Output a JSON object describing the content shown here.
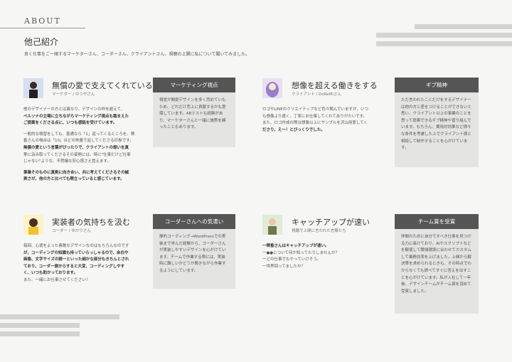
{
  "header": {
    "about": "ABOUT",
    "title": "他己紹介",
    "intro": "良く仕事をご一緒するマーケターさん、コーダーさん、クライアントさん、視聴の上関に私について聞いてみました。"
  },
  "cards": [
    {
      "title": "無償の愛で支えてくれている",
      "subtitle": "マーケター / のうやさん",
      "body": [
        "他のデザイナーの方とは異なり、デザインの枠を超えて、",
        "ベルソナの立場に立ちながらマーケティング視点も踏まえた",
        "ご提案をくださる点に、いつも感銘を受けています。",
        "一般的な慣習をしても、普通なら「1」返ってくるところを、稗",
        "畜さんの場合は「10」ほどの熱量で返してくださる印象です。",
        "無償の愛という言葉がぴったりで、クライアントの想いを真",
        "摯に汲み取ってくださるその姿勢には、時に\"仕事だけど仕事",
        "じゃない\"ような、不思議な安心感さえ覚えます。",
        "事業そのものに真剣に向き合い、共に考えてくださるその誠",
        "実さが、他の方と比べても際立っていると感じています。"
      ],
      "side_title": "マーケティング視点",
      "side_body": "視覚が間提デザインを多く売めていもため、どれだけ売上に貢献するかも意識しています。ABテストも経験があり、マーケターさんと一緒に施策を練ったこともあります。"
    },
    {
      "title": "想像を超える働きをする",
      "subtitle": "クライアント / DoReMiさん",
      "body": [
        "ロゴやLINEのクリエイティブなど色々頼んでいますが、いつ",
        "も想像より速く、丁寧にお仕事してくれてありがたいです。",
        "また、ロゴ作成の際は想像以上にサンプルを沢山用意してく",
        "ださり、え〜！とびっくりでした。"
      ],
      "side_title": "ギブ精神",
      "side_body": "ただ言われたことだけをするデザイナーは他の方と差をつけることができないと思い、クライアント以上の事業のことを思って提案できるギブ精神や習り組んでいます。もちろん、費用対効果など様々な条件を考慮した上でクライアント様と相談して制作することを心がけています。"
    },
    {
      "title": "実装者の気持ちを汲む",
      "subtitle": "コーダー / ゆかりさん",
      "body": [
        "毎回、心遣をよった素敵なデザインなのはもちろんなのです",
        "が、コーディングの知識も持っていらっしゃるので、余白や",
        "画像、文字サイズの統一といった細かな部分もきちんとされ",
        "ており、コーダー側からすると大変、コーディングしやす",
        "く、いつも助かっております。",
        "また、一緒にお仕事させてください！"
      ],
      "side_title": "コーダーさんへの気遣い",
      "side_body": "静的コーディング→WordPressでの実装まで学んだ経験から、コーダーさんが実装しやすいデザインを心がけています。チームで作業する際には、実装時に難しいかどうか聞きながら作業するようにしています。"
    },
    {
      "title": "キャッチアップが速い",
      "subtitle": "視聴で上関に言われた言葉たち",
      "body": [
        "一稗畜さんはキャッチアップが速い。",
        "一●●について何か知ってたりしませんか？",
        "一どの仕事でもやっていけそう。",
        "一世界回ってましたか？"
      ],
      "side_title": "チーム賞を受賞",
      "side_body": "仲間のために自分ですべき仕事を見つける力に長けており、AIやスクリプトなどを駆使して職場環境に合わせてカスタムして業務効率を上げました。上関から解決策を求められるときも、その時点でわからなくても調べてすぐに答えを出すことを心がけています。私が入社して一年後、デザインチームがチーム賞を頂めて受賞しました。"
    }
  ]
}
